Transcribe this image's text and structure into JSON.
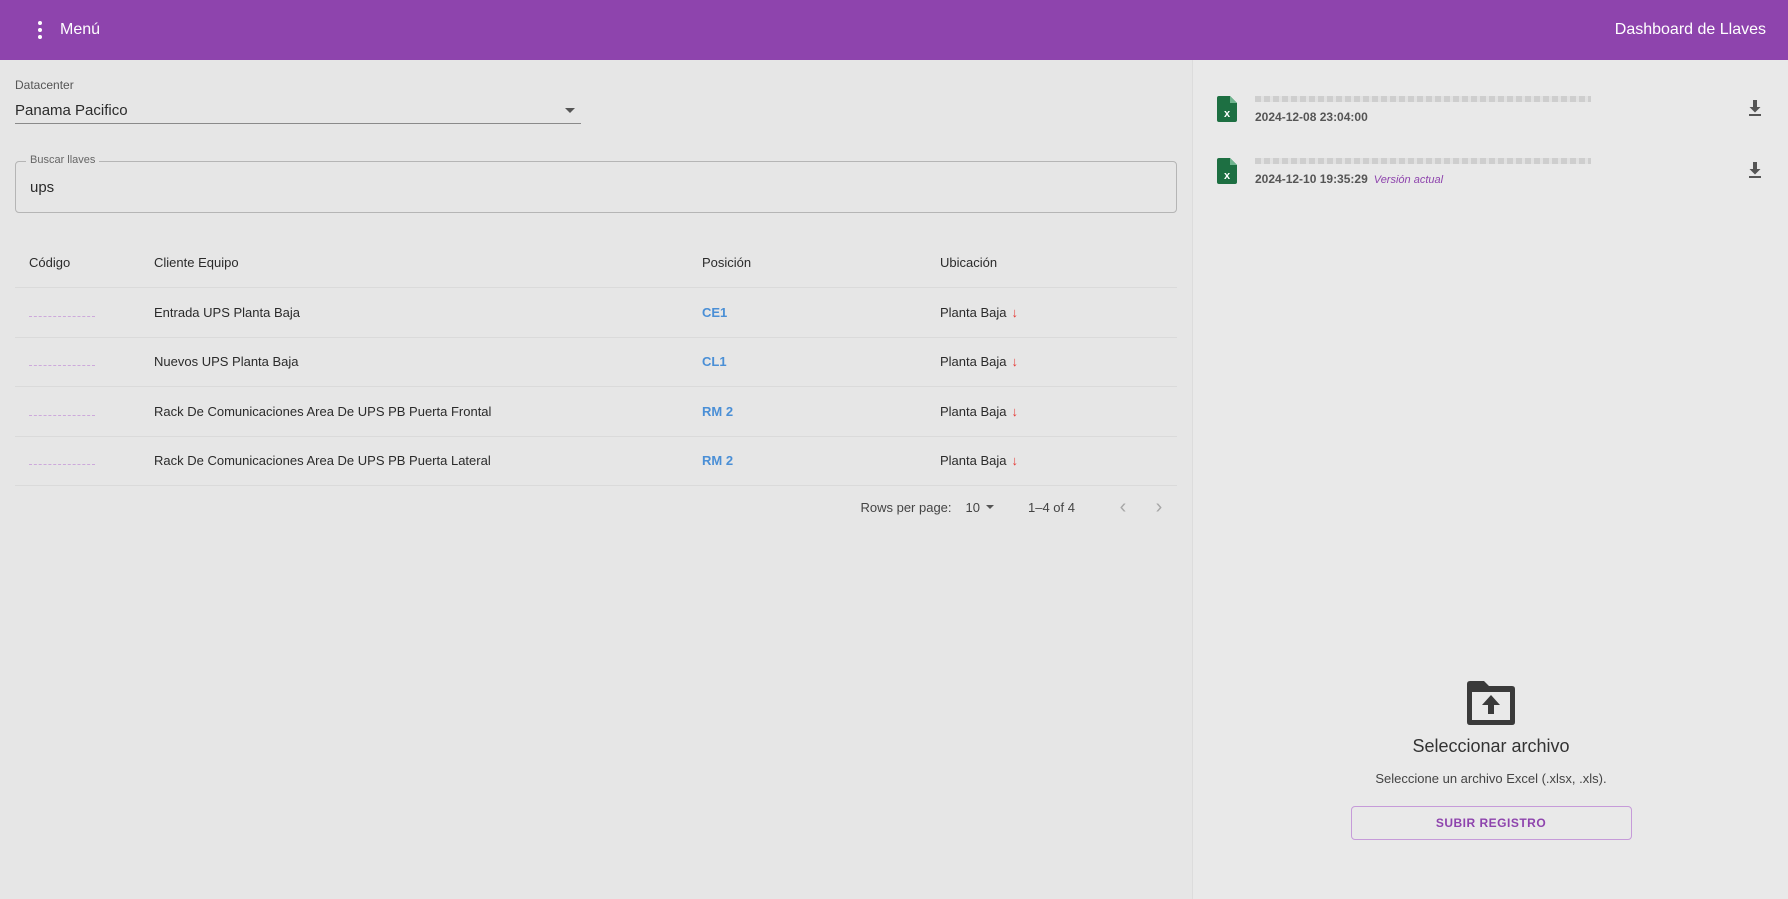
{
  "appbar": {
    "menu_label": "Menú",
    "title": "Dashboard de Llaves",
    "background": "#8e44ad"
  },
  "datacenter": {
    "label": "Datacenter",
    "value": "Panama Pacifico"
  },
  "search": {
    "label": "Buscar llaves",
    "value": "ups"
  },
  "table": {
    "headers": [
      "Código",
      "Cliente Equipo",
      "Posición",
      "Ubicación"
    ],
    "rows": [
      {
        "cliente": "Entrada UPS Planta Baja",
        "posicion": "CE1",
        "ubicacion": "Planta Baja",
        "arrow": "↓"
      },
      {
        "cliente": "Nuevos UPS Planta Baja",
        "posicion": "CL1",
        "ubicacion": "Planta Baja",
        "arrow": "↓"
      },
      {
        "cliente": "Rack De Comunicaciones Area De UPS PB Puerta Frontal",
        "posicion": "RM 2",
        "ubicacion": "Planta Baja",
        "arrow": "↓"
      },
      {
        "cliente": "Rack De Comunicaciones Area De UPS PB Puerta Lateral",
        "posicion": "RM 2",
        "ubicacion": "Planta Baja",
        "arrow": "↓"
      }
    ]
  },
  "pagination": {
    "rows_per_page_label": "Rows per page:",
    "rows_per_page_value": "10",
    "range": "1–4 of 4",
    "prev_icon": "‹",
    "next_icon": "›"
  },
  "files": [
    {
      "date": "2024-12-08 23:04:00",
      "badge": "",
      "icon": "excel-file-icon"
    },
    {
      "date": "2024-12-10 19:35:29",
      "badge": "Versión actual",
      "icon": "excel-file-icon"
    }
  ],
  "upload": {
    "title": "Seleccionar archivo",
    "description": "Seleccione un archivo Excel (.xlsx, .xls).",
    "button_label": "SUBIR REGISTRO",
    "icon": "folder-upload-icon"
  },
  "colors": {
    "accent": "#8e44ad",
    "link": "#4a8fd6",
    "arrow": "#e53935",
    "excel": "#1d6f42"
  }
}
